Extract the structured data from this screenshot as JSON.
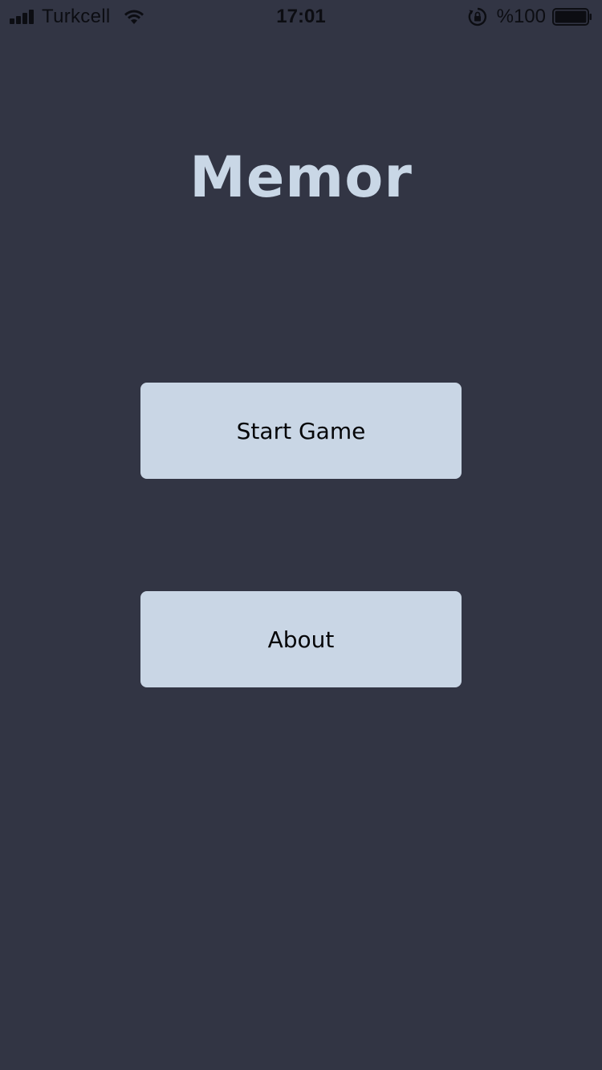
{
  "status_bar": {
    "carrier": "Turkcell",
    "time": "17:01",
    "battery_percent": "%100",
    "signal_icon": "cellular-signal-icon",
    "wifi_icon": "wifi-icon",
    "rotation_lock_icon": "rotation-lock-icon",
    "battery_icon": "battery-icon"
  },
  "app": {
    "title": "Memor"
  },
  "menu": {
    "start_label": "Start Game",
    "about_label": "About"
  },
  "colors": {
    "background": "#323544",
    "title": "#c9d7e6",
    "button_bg": "#c9d6e5",
    "button_text": "#050608"
  }
}
